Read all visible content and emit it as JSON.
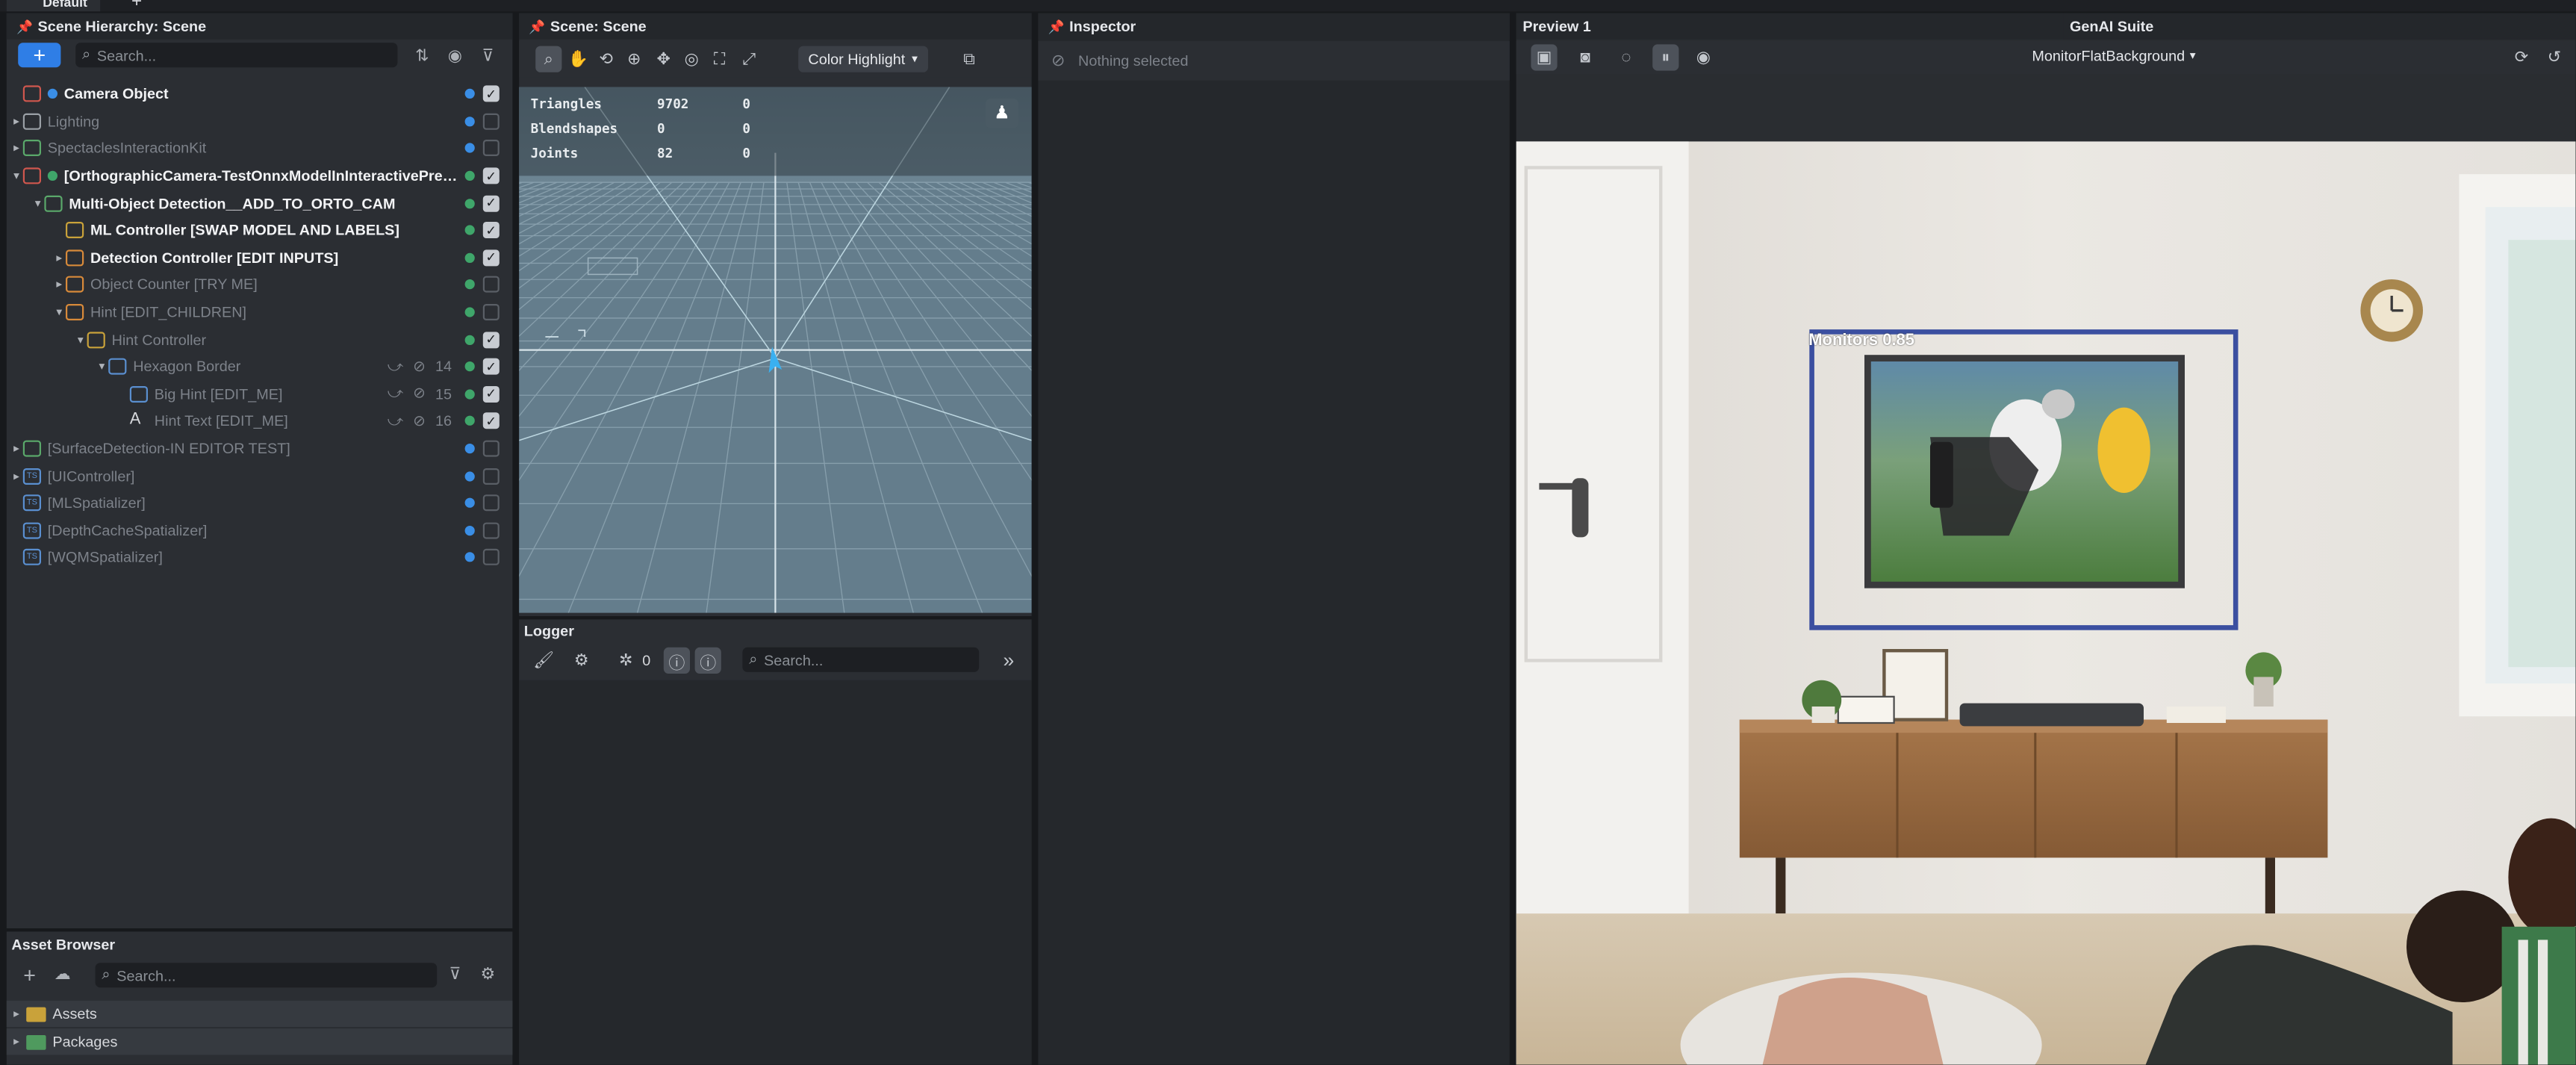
{
  "topbar": {
    "tab": "Default",
    "add": "+"
  },
  "hierarchy": {
    "title": "Scene Hierarchy: Scene",
    "search_placeholder": "Search...",
    "add_label": "+",
    "items": [
      {
        "label": "Camera Object",
        "depth": 0,
        "expander": "",
        "style": "bold",
        "icon": "camera-icon",
        "dot": "#3a8ee6",
        "checked": true,
        "extra": "prefab-dot"
      },
      {
        "label": "Lighting",
        "depth": 0,
        "expander": "▸",
        "style": "dim",
        "icon": "light-icon",
        "dot": "#3a8ee6",
        "checked": false
      },
      {
        "label": "SpectaclesInteractionKit",
        "depth": 0,
        "expander": "▸",
        "style": "dim",
        "icon": "prefab-icon",
        "dot": "#3a8ee6",
        "checked": false
      },
      {
        "label": "[OrthographicCamera-TestOnnxModelInInteractivePreview]",
        "depth": 0,
        "expander": "▾",
        "style": "bold",
        "icon": "camera-icon",
        "dot": "#3fa66a",
        "checked": true,
        "extra": "prefab-dot-green"
      },
      {
        "label": "Multi-Object Detection__ADD_TO_ORTO_CAM",
        "depth": 1,
        "expander": "▾",
        "style": "bold",
        "icon": "prefab-icon",
        "dot": "#3fa66a",
        "checked": true
      },
      {
        "label": "ML Controller [SWAP MODEL AND LABELS]",
        "depth": 2,
        "expander": "",
        "style": "bold",
        "icon": "script-icon",
        "dot": "#3fa66a",
        "checked": true
      },
      {
        "label": "Detection Controller [EDIT INPUTS]",
        "depth": 2,
        "expander": "▸",
        "style": "bold",
        "icon": "object-icon",
        "dot": "#3fa66a",
        "checked": true
      },
      {
        "label": "Object Counter [TRY ME]",
        "depth": 2,
        "expander": "▸",
        "style": "dim",
        "icon": "object-icon",
        "dot": "#3fa66a",
        "checked": false
      },
      {
        "label": "Hint [EDIT_CHILDREN]",
        "depth": 2,
        "expander": "▾",
        "style": "dim",
        "icon": "object-icon",
        "dot": "#3fa66a",
        "checked": false
      },
      {
        "label": "Hint Controller",
        "depth": 3,
        "expander": "▾",
        "style": "dim",
        "icon": "script-icon",
        "dot": "#3fa66a",
        "checked": true
      },
      {
        "label": "Hexagon Border",
        "depth": 4,
        "expander": "▾",
        "style": "dim",
        "icon": "image-icon",
        "dot": "#3fa66a",
        "checked": true,
        "layer": "14"
      },
      {
        "label": "Big Hint [EDIT_ME]",
        "depth": 5,
        "expander": "",
        "style": "dim",
        "icon": "image-icon",
        "dot": "#3fa66a",
        "checked": true,
        "layer": "15"
      },
      {
        "label": "Hint Text [EDIT_ME]",
        "depth": 5,
        "expander": "",
        "style": "dim",
        "icon": "text-icon",
        "dot": "#3fa66a",
        "checked": true,
        "layer": "16"
      },
      {
        "label": "[SurfaceDetection-IN EDITOR TEST]",
        "depth": 0,
        "expander": "▸",
        "style": "dim",
        "icon": "prefab-icon",
        "dot": "#3a8ee6",
        "checked": false
      },
      {
        "label": "[UIController]",
        "depth": 0,
        "expander": "▸",
        "style": "dim",
        "icon": "ts-icon",
        "dot": "#3a8ee6",
        "checked": false
      },
      {
        "label": "[MLSpatializer]",
        "depth": 0,
        "expander": "",
        "style": "dim",
        "icon": "ts-icon",
        "dot": "#3a8ee6",
        "checked": false
      },
      {
        "label": "[DepthCacheSpatializer]",
        "depth": 0,
        "expander": "",
        "style": "dim",
        "icon": "ts-icon",
        "dot": "#3a8ee6",
        "checked": false
      },
      {
        "label": "[WQMSpatializer]",
        "depth": 0,
        "expander": "",
        "style": "dim",
        "icon": "ts-icon",
        "dot": "#3a8ee6",
        "checked": false
      }
    ]
  },
  "assets": {
    "title": "Asset Browser",
    "search_placeholder": "Search...",
    "items": [
      {
        "label": "Assets"
      },
      {
        "label": "Packages"
      }
    ]
  },
  "scene": {
    "title": "Scene: Scene",
    "mode": "Color Highlight",
    "stats": [
      {
        "name": "Triangles",
        "a": "9702",
        "b": "0"
      },
      {
        "name": "Blendshapes",
        "a": "0",
        "b": "0"
      },
      {
        "name": "Joints",
        "a": "82",
        "b": "0"
      }
    ]
  },
  "logger": {
    "title": "Logger",
    "bug_count": "0",
    "search_placeholder": "Search..."
  },
  "inspector": {
    "title": "Inspector",
    "empty": "Nothing selected"
  },
  "preview": {
    "title": "Preview 1",
    "genai": "GenAI Suite",
    "background": "MonitorFlatBackground",
    "detection_label": "Monitors 0.85"
  },
  "colors": {
    "accent": "#2f7ee6",
    "detection_box": "#3b4fa0"
  }
}
